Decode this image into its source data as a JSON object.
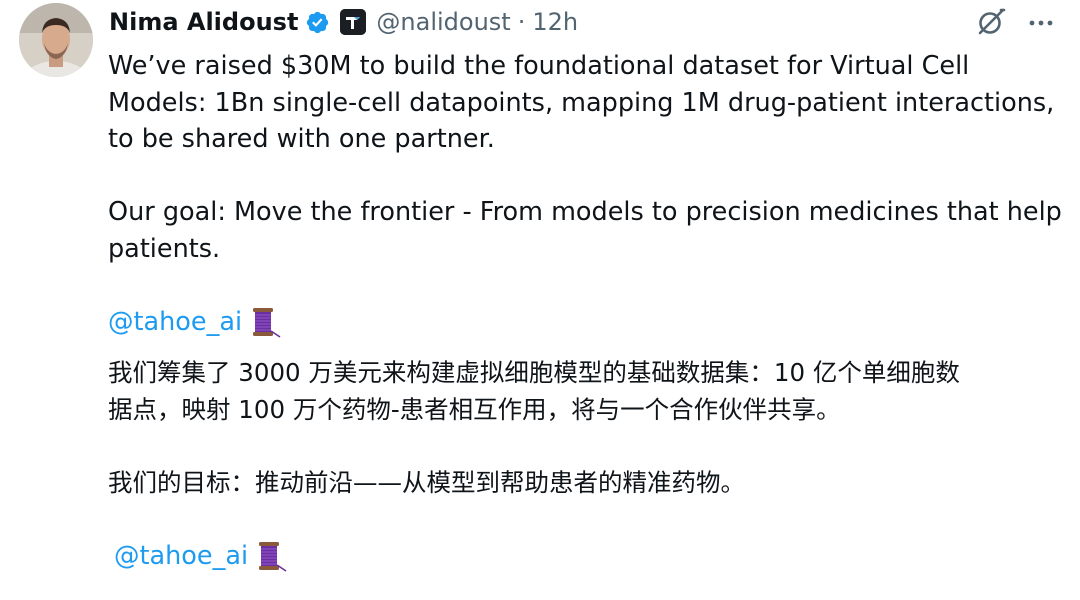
{
  "author": {
    "name": "Nima Alidoust",
    "handle": "@nalidoust",
    "separator": "·",
    "time": "12h",
    "verified": true,
    "avatar_icon": "avatar-photo",
    "affiliation_icon": "tahoe-logo-icon"
  },
  "actions": {
    "grok_icon": "grok-icon",
    "more_icon": "more-icon"
  },
  "tweet": {
    "p1_lines": [
      "We’ve raised $30M to build the foundational dataset for Virtual Cell",
      "Models: 1Bn single-cell datapoints, mapping 1M drug-patient interactions,",
      "to be shared with one partner."
    ],
    "p2_lines": [
      "Our goal: Move the frontier - From models to precision medicines that help",
      "patients."
    ],
    "mention1": "@tahoe_ai",
    "zh1_lines": [
      "我们筹集了 3000 万美元来构建虚拟细胞模型的基础数据集：10 亿个单细胞数",
      "据点，映射 100 万个药物-患者相互作用，将与一个合作伙伴共享。"
    ],
    "zh2_lines": [
      "我们的目标：推动前沿——从模型到帮助患者的精准药物。"
    ],
    "mention2": "@tahoe_ai",
    "spool_emoji": "thread-spool-emoji"
  },
  "colors": {
    "text": "#0f1419",
    "secondary": "#536471",
    "link": "#1d9bf0",
    "verified": "#1d9bf0"
  }
}
